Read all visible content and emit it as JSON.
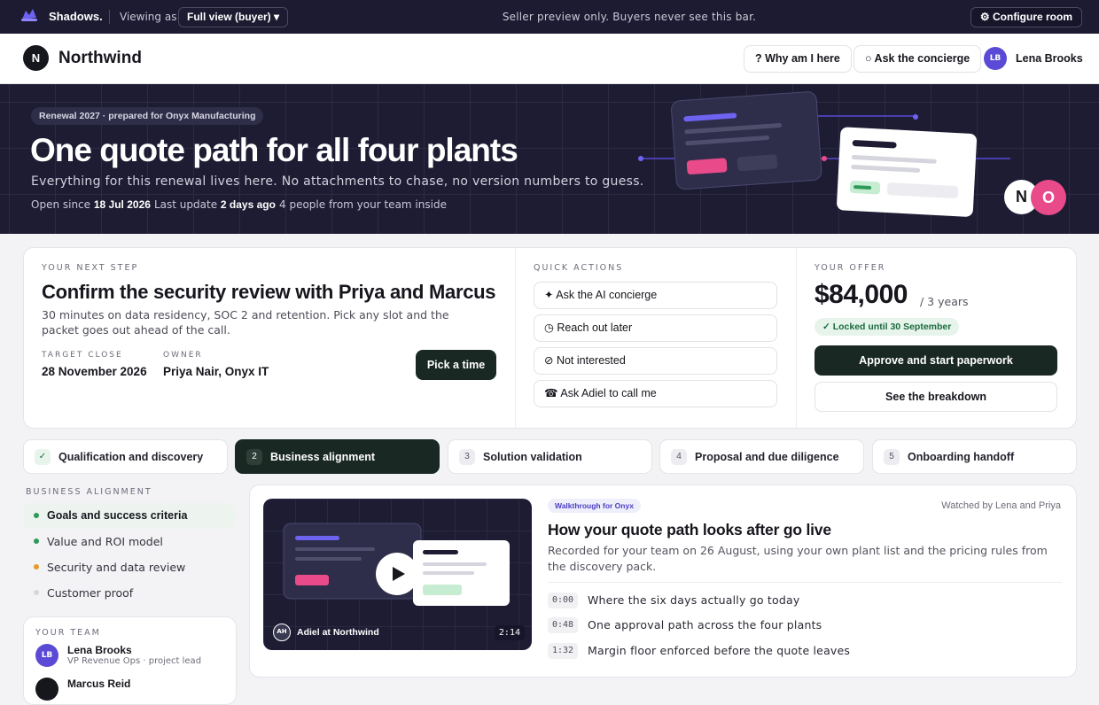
{
  "topbar": {
    "brand": "Shadows.",
    "viewing_label": "Viewing as",
    "view_mode": "Full view (buyer) ▾",
    "preview_notice": "Seller preview only. Buyers never see this bar.",
    "configure": "⚙ Configure room"
  },
  "header": {
    "avatar_initial": "N",
    "company": "Northwind",
    "why_button": "? Why am I here",
    "concierge_button": "○ Ask the concierge",
    "user_initials": "LB",
    "user_name": "Lena Brooks"
  },
  "hero": {
    "tag": "Renewal 2027 · prepared for Onyx Manufacturing",
    "title": "One quote path for all four plants",
    "subtitle": "Everything for this renewal lives here. No attachments to chase, no version numbers to guess.",
    "open_since_label": "Open since",
    "open_since_value": "18 Jul 2026",
    "last_update_label": "Last update",
    "last_update_value": "2 days ago",
    "people": "4 people from your team inside",
    "logo_n": "N",
    "logo_o": "O"
  },
  "next_step": {
    "eyebrow": "YOUR NEXT STEP",
    "title": "Confirm the security review with Priya and Marcus",
    "description": "30 minutes on data residency, SOC 2 and retention. Pick any slot and the packet goes out ahead of the call.",
    "target_close_label": "TARGET CLOSE",
    "target_close_value": "28 November 2026",
    "owner_label": "OWNER",
    "owner_value": "Priya Nair, Onyx IT",
    "cta": "Pick a time"
  },
  "quick_actions": {
    "eyebrow": "QUICK ACTIONS",
    "items": [
      "✦ Ask the AI concierge",
      "◷ Reach out later",
      "⊘ Not interested",
      "☎ Ask Adiel to call me"
    ]
  },
  "offer": {
    "eyebrow": "YOUR OFFER",
    "price": "$84,000",
    "term": "/ 3 years",
    "locked": "✓ Locked until 30 September",
    "approve": "Approve and start paperwork",
    "breakdown": "See the breakdown"
  },
  "stages": [
    {
      "num": "✓",
      "label": "Qualification and discovery"
    },
    {
      "num": "2",
      "label": "Business alignment"
    },
    {
      "num": "3",
      "label": "Solution validation"
    },
    {
      "num": "4",
      "label": "Proposal and due diligence"
    },
    {
      "num": "5",
      "label": "Onboarding handoff"
    }
  ],
  "section": {
    "eyebrow": "BUSINESS ALIGNMENT",
    "items": [
      "Goals and success criteria",
      "Value and ROI model",
      "Security and data review",
      "Customer proof"
    ]
  },
  "team": {
    "eyebrow": "YOUR TEAM",
    "members": [
      {
        "initials": "LB",
        "name": "Lena Brooks",
        "role": "VP Revenue Ops · project lead"
      },
      {
        "initials": "",
        "name": "Marcus Reid",
        "role": ""
      }
    ]
  },
  "video": {
    "presenter_initials": "AH",
    "presenter": "Adiel at Northwind",
    "duration": "2:14",
    "tag": "Walkthrough for Onyx",
    "watched": "Watched by Lena and Priya",
    "title": "How your quote path looks after go live",
    "description": "Recorded for your team on 26 August, using your own plant list and the pricing rules from the discovery pack.",
    "chapters": [
      {
        "time": "0:00",
        "title": "Where the six days actually go today"
      },
      {
        "time": "0:48",
        "title": "One approval path across the four plants"
      },
      {
        "time": "1:32",
        "title": "Margin floor enforced before the quote leaves"
      }
    ]
  },
  "colors": {
    "dark": "#1c1b31",
    "accent_green": "#192822",
    "accent_purple": "#5a4ad6",
    "pink": "#e94a8a"
  }
}
